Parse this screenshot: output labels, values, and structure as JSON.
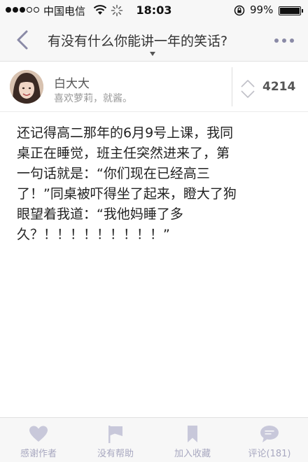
{
  "status_bar": {
    "carrier": "中国电信",
    "time": "18:03",
    "battery": "99%",
    "battery_level": 0.99,
    "signal_filled": 3,
    "signal_total": 5
  },
  "nav": {
    "title": "有没有什么你能讲一年的笑话?",
    "back_icon": "chevron-left-icon",
    "more_icon": "more-dots-icon"
  },
  "author": {
    "name": "白大大",
    "bio": "喜欢萝莉，就酱。",
    "votes": "4214"
  },
  "answer": {
    "lines": [
      "还记得高二那年的6月9号上课，我同",
      "桌正在睡觉，班主任突然进来了，第",
      "一句话就是：“你们现在已经高三",
      "了！”同桌被吓得坐了起来，瞪大了狗",
      "眼望着我道：“我他妈睡了多",
      "久？！！！！！！！！！”"
    ]
  },
  "toolbar": {
    "items": [
      {
        "label": "感谢作者",
        "icon": "heart-icon"
      },
      {
        "label": "没有帮助",
        "icon": "flag-icon"
      },
      {
        "label": "加入收藏",
        "icon": "bookmark-icon"
      },
      {
        "label": "评论(181)",
        "icon": "comment-icon"
      }
    ]
  },
  "colors": {
    "accent": "#8a8aa6",
    "toolbar_icon": "#c8c8da",
    "toolbar_label": "#a8a8c0"
  }
}
